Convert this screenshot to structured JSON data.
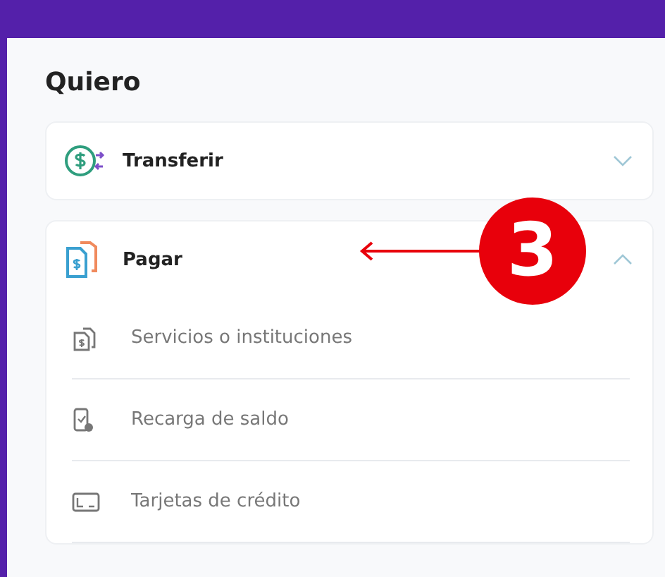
{
  "heading": "Quiero",
  "sections": [
    {
      "title": "Transferir",
      "kind": "transfer",
      "expanded": false
    },
    {
      "title": "Pagar",
      "kind": "bill",
      "expanded": true,
      "items": [
        {
          "label": "Servicios o instituciones",
          "kind": "bill"
        },
        {
          "label": "Recarga de saldo",
          "kind": "phone"
        },
        {
          "label": "Tarjetas de crédito",
          "kind": "card"
        }
      ]
    }
  ],
  "callout": {
    "number": "3"
  }
}
